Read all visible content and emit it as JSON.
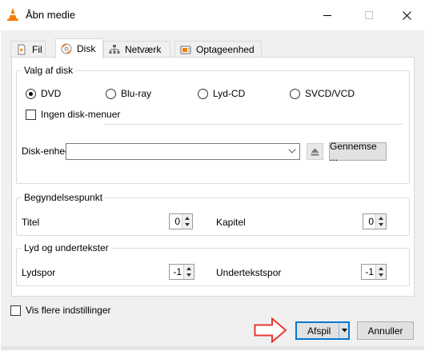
{
  "window": {
    "title": "Åbn medie"
  },
  "tabs": [
    {
      "label": "Fil",
      "icon": "file-icon"
    },
    {
      "label": "Disk",
      "icon": "disc-icon"
    },
    {
      "label": "Netværk",
      "icon": "network-icon"
    },
    {
      "label": "Optageenhed",
      "icon": "capture-device-icon"
    }
  ],
  "disc_selection": {
    "title": "Valg af disk",
    "options": [
      "DVD",
      "Blu-ray",
      "Lyd-CD",
      "SVCD/VCD"
    ],
    "selected": "DVD",
    "no_menus_label": "Ingen disk-menuer",
    "device_label": "Disk-enhed",
    "device_value": "",
    "browse_label": "Gennemse ..."
  },
  "starting_position": {
    "title": "Begyndelsespunkt",
    "title_label": "Titel",
    "title_value": "0",
    "chapter_label": "Kapitel",
    "chapter_value": "0"
  },
  "audio_subtitles": {
    "title": "Lyd og undertekster",
    "audio_label": "Lydspor",
    "audio_value": "-1",
    "subtitle_label": "Undertekstspor",
    "subtitle_value": "-1"
  },
  "more_options_label": "Vis flere indstillinger",
  "buttons": {
    "play": "Afspil",
    "cancel": "Annuller"
  },
  "colors": {
    "accent": "#0078d7",
    "annotation_arrow": "#e53935",
    "vlc_orange": "#f57c00"
  }
}
